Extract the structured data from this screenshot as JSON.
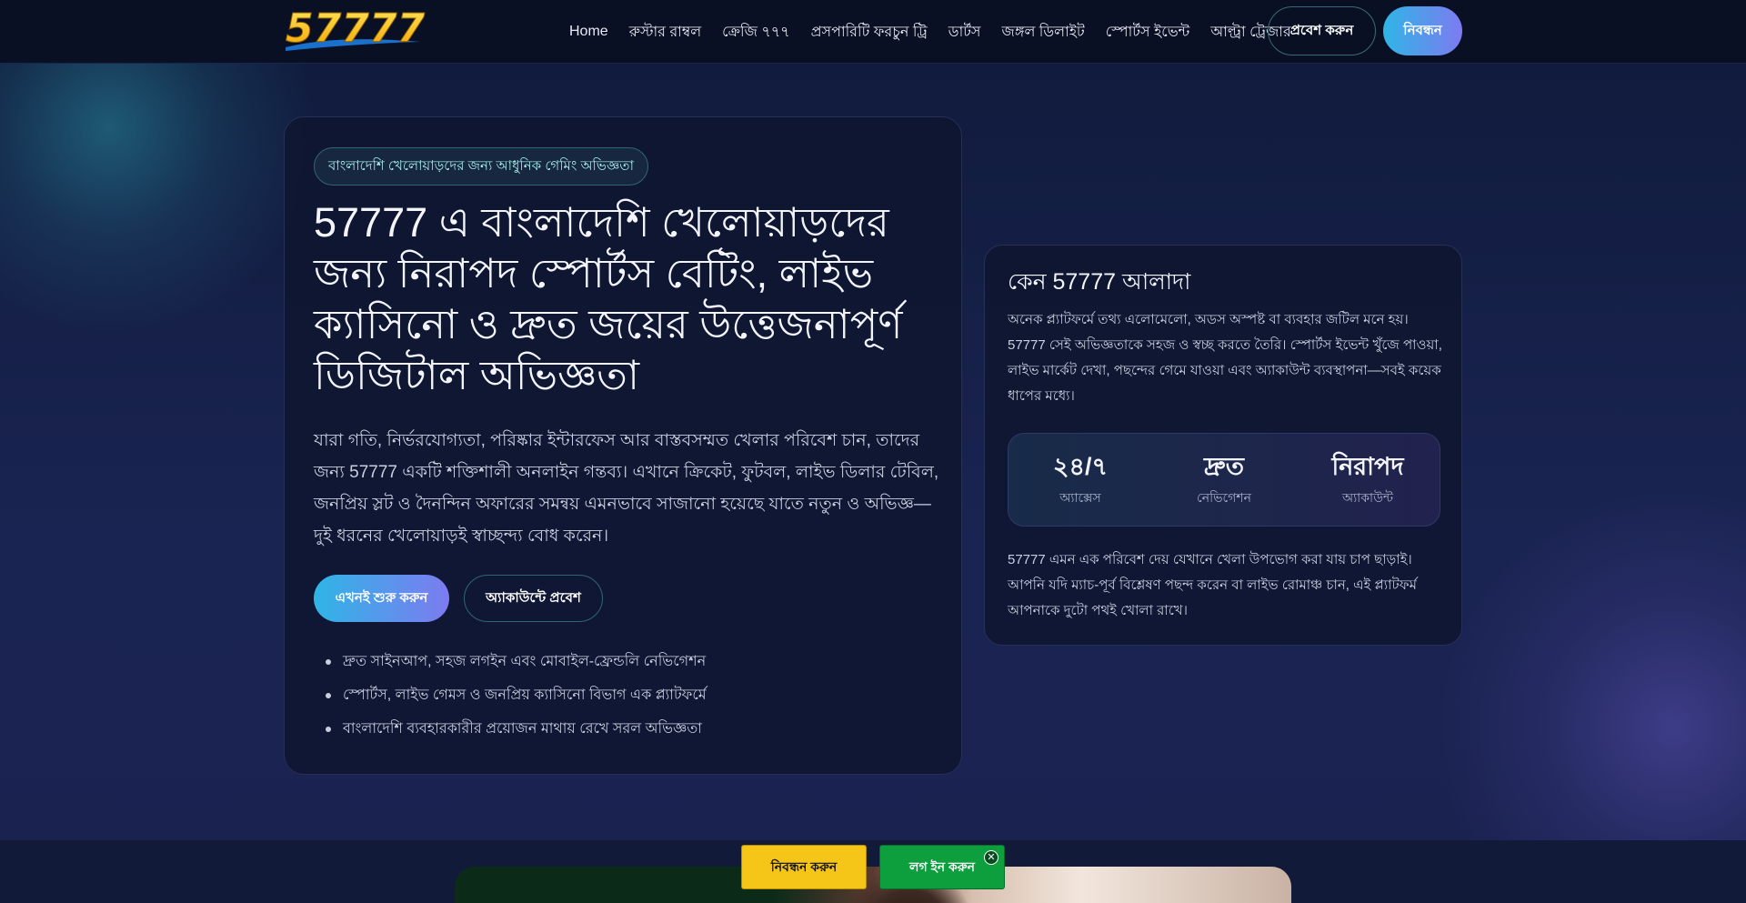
{
  "header": {
    "logo_text": "57777",
    "nav": [
      {
        "label": "Home"
      },
      {
        "label": "রুস্টার রাম্বল"
      },
      {
        "label": "ক্রেজি ৭৭৭"
      },
      {
        "label": "প্রসপারিটি ফরচুন ট্রি"
      },
      {
        "label": "ডার্টস"
      },
      {
        "label": "জঙ্গল ডিলাইট"
      },
      {
        "label": "স্পোর্টস ইভেন্ট"
      },
      {
        "label": "আল্ট্রা ট্রেজার"
      }
    ],
    "login_label": "প্রবেশ করুন",
    "register_label": "নিবন্ধন"
  },
  "hero": {
    "badge": "বাংলাদেশি খেলোয়াড়দের জন্য আধুনিক গেমিং অভিজ্ঞতা",
    "title": "57777 এ বাংলাদেশি খেলোয়াড়দের জন্য নিরাপদ স্পোর্টস বেটিং, লাইভ ক্যাসিনো ও দ্রুত জয়ের উত্তেজনাপূর্ণ ডিজিটাল অভিজ্ঞতা",
    "lead": "যারা গতি, নির্ভরযোগ্যতা, পরিষ্কার ইন্টারফেস আর বাস্তবসম্মত খেলার পরিবেশ চান, তাদের জন্য 57777 একটি শক্তিশালী অনলাইন গন্তব্য। এখানে ক্রিকেট, ফুটবল, লাইভ ডিলার টেবিল, জনপ্রিয় স্লট ও দৈনন্দিন অফারের সমন্বয় এমনভাবে সাজানো হয়েছে যাতে নতুন ও অভিজ্ঞ—দুই ধরনের খেলোয়াড়ই স্বাচ্ছন্দ্য বোধ করেন।",
    "start_label": "এখনই শুরু করুন",
    "account_label": "অ্যাকাউন্টে প্রবেশ",
    "features": [
      "দ্রুত সাইনআপ, সহজ লগইন এবং মোবাইল-ফ্রেন্ডলি নেভিগেশন",
      "স্পোর্টস, লাইভ গেমস ও জনপ্রিয় ক্যাসিনো বিভাগ এক প্ল্যাটফর্মে",
      "বাংলাদেশি ব্যবহারকারীর প্রয়োজন মাথায় রেখে সরল অভিজ্ঞতা"
    ]
  },
  "side": {
    "title": "কেন 57777 আলাদা",
    "p1": "অনেক প্ল্যাটফর্মে তথ্য এলোমেলো, অডস অস্পষ্ট বা ব্যবহার জটিল মনে হয়। 57777 সেই অভিজ্ঞতাকে সহজ ও স্বচ্ছ করতে তৈরি। স্পোর্টস ইভেন্ট খুঁজে পাওয়া, লাইভ মার্কেট দেখা, পছন্দের গেমে যাওয়া এবং অ্যাকাউন্ট ব্যবস্থাপনা—সবই কয়েক ধাপের মধ্যে।",
    "stats": [
      {
        "value": "২৪/৭",
        "label": "অ্যাক্সেস"
      },
      {
        "value": "দ্রুত",
        "label": "নেভিগেশন"
      },
      {
        "value": "নিরাপদ",
        "label": "অ্যাকাউন্ট"
      }
    ],
    "p2": "57777 এমন এক পরিবেশ দেয় যেখানে খেলা উপভোগ করা যায় চাপ ছাড়াই। আপনি যদি ম্যাচ-পূর্ব বিশ্লেষণ পছন্দ করেন বা লাইভ রোমাঞ্চ চান, এই প্ল্যাটফর্ম আপনাকে দুটো পথই খোলা রাখে।"
  },
  "floating": {
    "register_label": "নিবন্ধন করুন",
    "login_label": "লগ ইন করুন",
    "close_symbol": "✕"
  },
  "colors": {
    "accent_gradient_start": "#2fb5e6",
    "accent_gradient_end": "#7d7bf0",
    "float_register": "#f5c518",
    "float_login": "#0d9e3e"
  }
}
